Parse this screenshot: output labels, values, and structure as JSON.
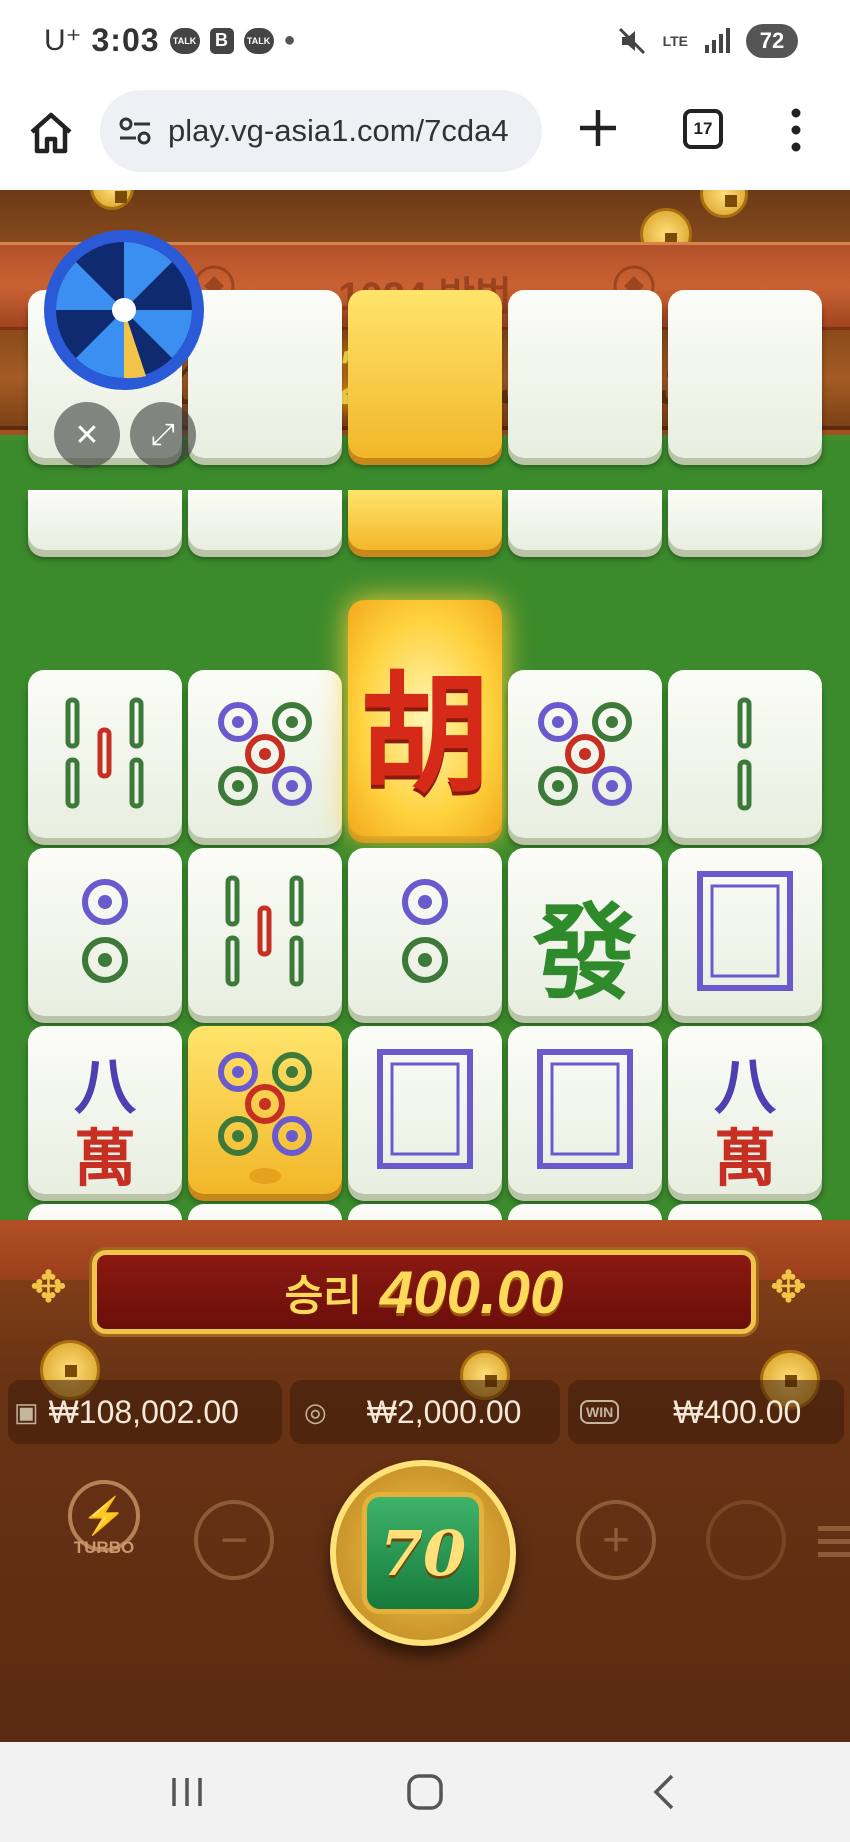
{
  "status_bar": {
    "carrier": "U⁺",
    "time": "3:03",
    "talk_badge": "TALK",
    "b_badge": "B",
    "network": "LTE",
    "battery": "72"
  },
  "browser": {
    "url": "play.vg-asia1.com/7cda4",
    "tab_count": "17"
  },
  "game": {
    "title": "1024 방법",
    "multipliers": [
      {
        "label": "x1",
        "active": false
      },
      {
        "label": "x2",
        "active": true
      },
      {
        "label": "x3",
        "active": false
      },
      {
        "label": "x5",
        "active": false
      }
    ],
    "hu_glyph": "胡",
    "fa_glyph": "發",
    "eight_glyph": "八",
    "wan_glyph": "萬",
    "win_label": "승리",
    "win_amount": "400.00",
    "balance": "₩108,002.00",
    "bet": "₩2,000.00",
    "last_win": "₩400.00",
    "win_icon_text": "WIN",
    "spin_label": "70",
    "turbo_label": "TURBO"
  },
  "colors": {
    "felt": "#3f8f2f",
    "gold": "#ffd95a",
    "blue_pip": "#6a5acd",
    "green_pip": "#3d7a3a",
    "red_pip": "#c62f22"
  }
}
